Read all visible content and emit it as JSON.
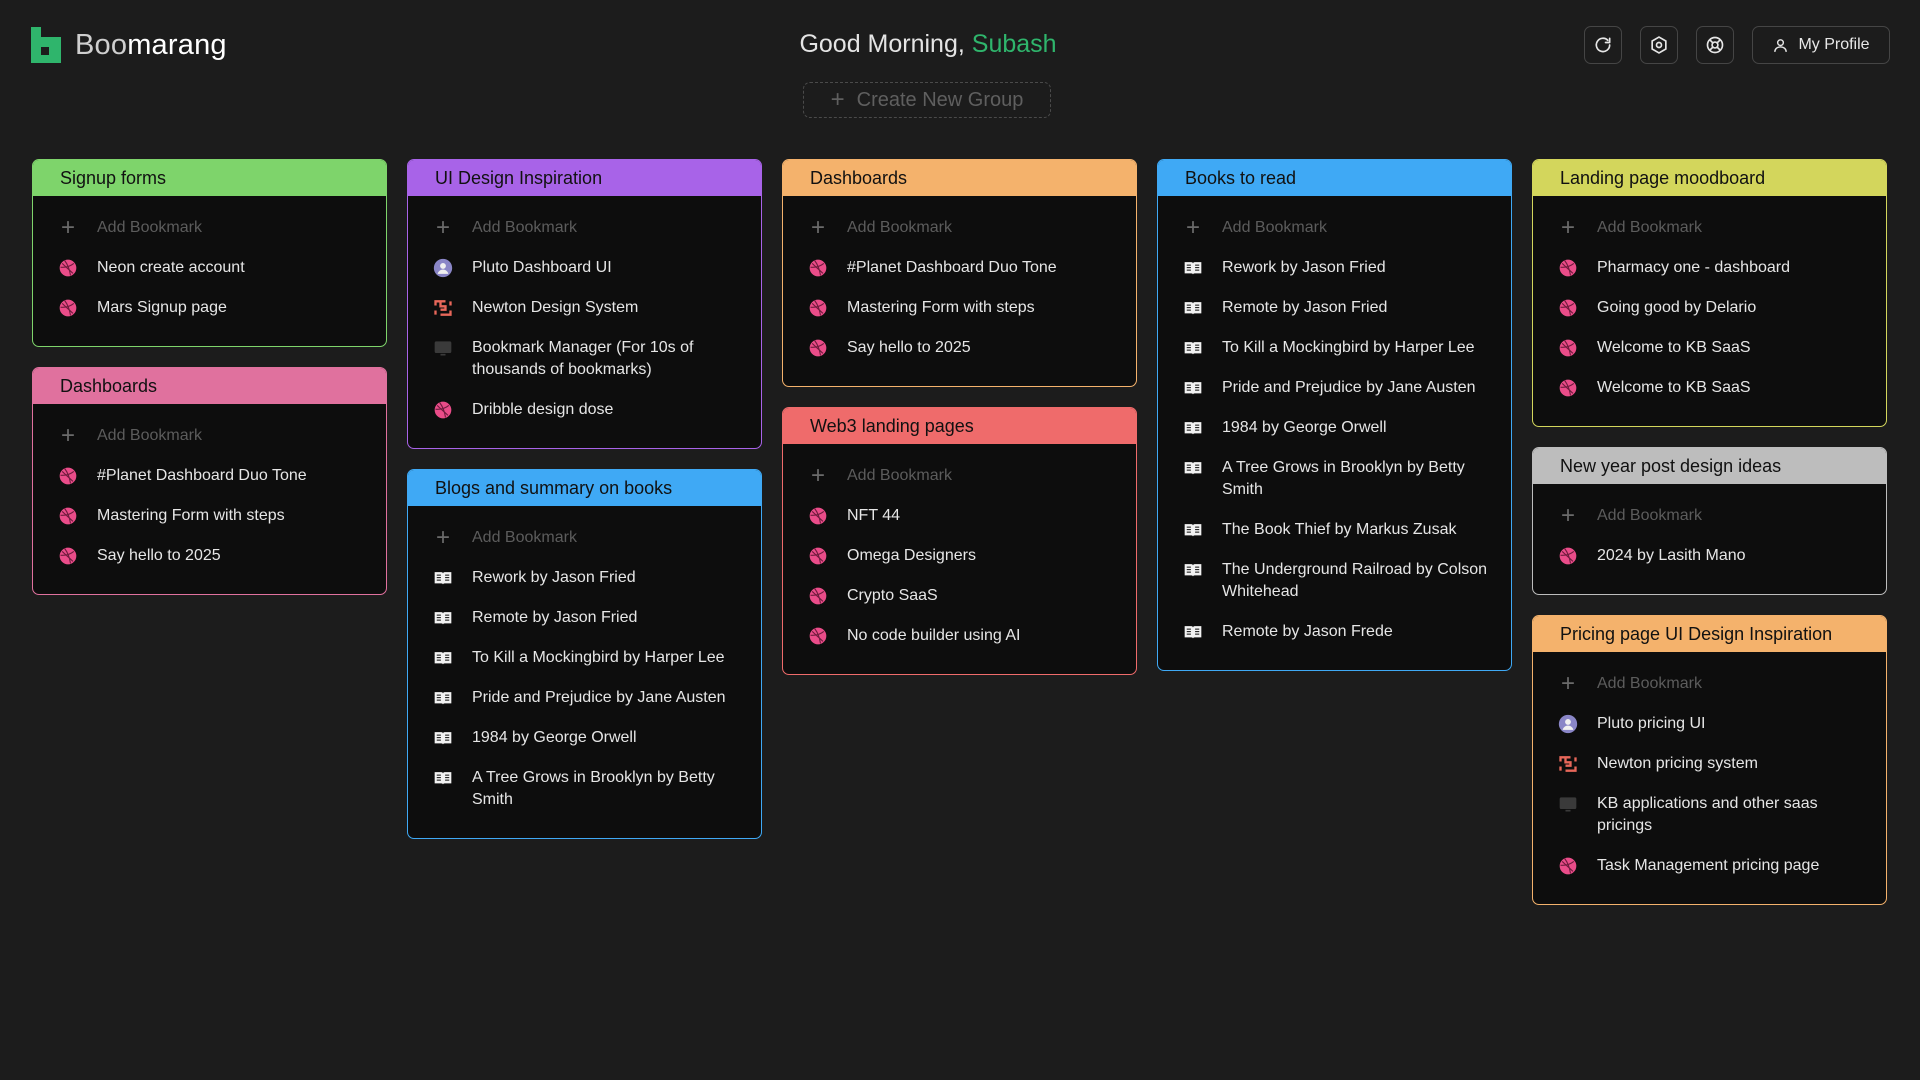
{
  "app": {
    "name_part1": "Boo",
    "name_part2": "marang"
  },
  "header": {
    "greeting": "Good Morning,",
    "user_name": "Subash",
    "create_group_label": "Create New Group",
    "profile_label": "My Profile"
  },
  "colors": {
    "accent_green": "#2fb56c",
    "green": "#7ed46b",
    "purple": "#a863e8",
    "orange": "#f4b26c",
    "blue": "#3fa9f5",
    "yellow": "#d3d65c",
    "pink": "#e0719e",
    "red": "#ef6b6b",
    "gray": "#bdbdbd"
  },
  "add_bookmark_label": "Add Bookmark",
  "groups": [
    {
      "title": "Signup forms",
      "items": [
        {
          "icon": "dribbble-icon",
          "label": "Neon create account"
        },
        {
          "icon": "dribbble-icon",
          "label": "Mars Signup page"
        }
      ]
    },
    {
      "title": "Dashboards",
      "items": [
        {
          "icon": "dribbble-icon",
          "label": "#Planet Dashboard Duo Tone"
        },
        {
          "icon": "dribbble-icon",
          "label": "Mastering Form with steps"
        },
        {
          "icon": "dribbble-icon",
          "label": "Say hello to 2025"
        }
      ]
    },
    {
      "title": "UI Design Inspiration",
      "items": [
        {
          "icon": "avatar-icon",
          "label": "Pluto Dashboard UI"
        },
        {
          "icon": "newton-icon",
          "label": "Newton Design System"
        },
        {
          "icon": "monitor-icon",
          "label": "Bookmark Manager (For 10s of thousands of bookmarks)"
        },
        {
          "icon": "dribbble-icon",
          "label": "Dribble design dose"
        }
      ]
    },
    {
      "title": "Blogs and summary on books",
      "items": [
        {
          "icon": "book-icon",
          "label": "Rework by Jason Fried"
        },
        {
          "icon": "book-icon",
          "label": "Remote by Jason Fried"
        },
        {
          "icon": "book-icon",
          "label": "To Kill a Mockingbird by Harper Lee"
        },
        {
          "icon": "book-icon",
          "label": "Pride and Prejudice by Jane Austen"
        },
        {
          "icon": "book-icon",
          "label": "1984 by George Orwell"
        },
        {
          "icon": "book-icon",
          "label": "A Tree Grows in Brooklyn by Betty Smith"
        }
      ]
    },
    {
      "title": "Dashboards",
      "items": [
        {
          "icon": "dribbble-icon",
          "label": "#Planet Dashboard Duo Tone"
        },
        {
          "icon": "dribbble-icon",
          "label": "Mastering Form with steps"
        },
        {
          "icon": "dribbble-icon",
          "label": "Say hello to 2025"
        }
      ]
    },
    {
      "title": "Web3 landing pages",
      "items": [
        {
          "icon": "dribbble-icon",
          "label": "NFT 44"
        },
        {
          "icon": "dribbble-icon",
          "label": "Omega Designers"
        },
        {
          "icon": "dribbble-icon",
          "label": "Crypto SaaS"
        },
        {
          "icon": "dribbble-icon",
          "label": "No code builder using AI"
        }
      ]
    },
    {
      "title": "Books to read",
      "items": [
        {
          "icon": "book-icon",
          "label": "Rework by Jason Fried"
        },
        {
          "icon": "book-icon",
          "label": "Remote by Jason Fried"
        },
        {
          "icon": "book-icon",
          "label": "To Kill a Mockingbird by Harper Lee"
        },
        {
          "icon": "book-icon",
          "label": "Pride and Prejudice by Jane Austen"
        },
        {
          "icon": "book-icon",
          "label": "1984 by George Orwell"
        },
        {
          "icon": "book-icon",
          "label": "A Tree Grows in Brooklyn by Betty Smith"
        },
        {
          "icon": "book-icon",
          "label": "The Book Thief by Markus Zusak"
        },
        {
          "icon": "book-icon",
          "label": "The Underground Railroad by Colson Whitehead"
        },
        {
          "icon": "book-icon",
          "label": "Remote by Jason Frede"
        }
      ]
    },
    {
      "title": "Landing page moodboard",
      "items": [
        {
          "icon": "dribbble-icon",
          "label": "Pharmacy one - dashboard"
        },
        {
          "icon": "dribbble-icon",
          "label": "Going good by Delario"
        },
        {
          "icon": "dribbble-icon",
          "label": "Welcome to KB SaaS"
        },
        {
          "icon": "dribbble-icon",
          "label": "Welcome to KB SaaS"
        }
      ]
    },
    {
      "title": "New year post design ideas",
      "items": [
        {
          "icon": "dribbble-icon",
          "label": "2024 by Lasith Mano"
        }
      ]
    },
    {
      "title": "Pricing page UI Design Inspiration",
      "items": [
        {
          "icon": "avatar-icon",
          "label": "Pluto pricing UI"
        },
        {
          "icon": "newton-icon",
          "label": "Newton pricing system"
        },
        {
          "icon": "monitor-icon",
          "label": "KB applications and other saas pricings"
        },
        {
          "icon": "dribbble-icon",
          "label": "Task Management pricing page"
        }
      ]
    }
  ]
}
